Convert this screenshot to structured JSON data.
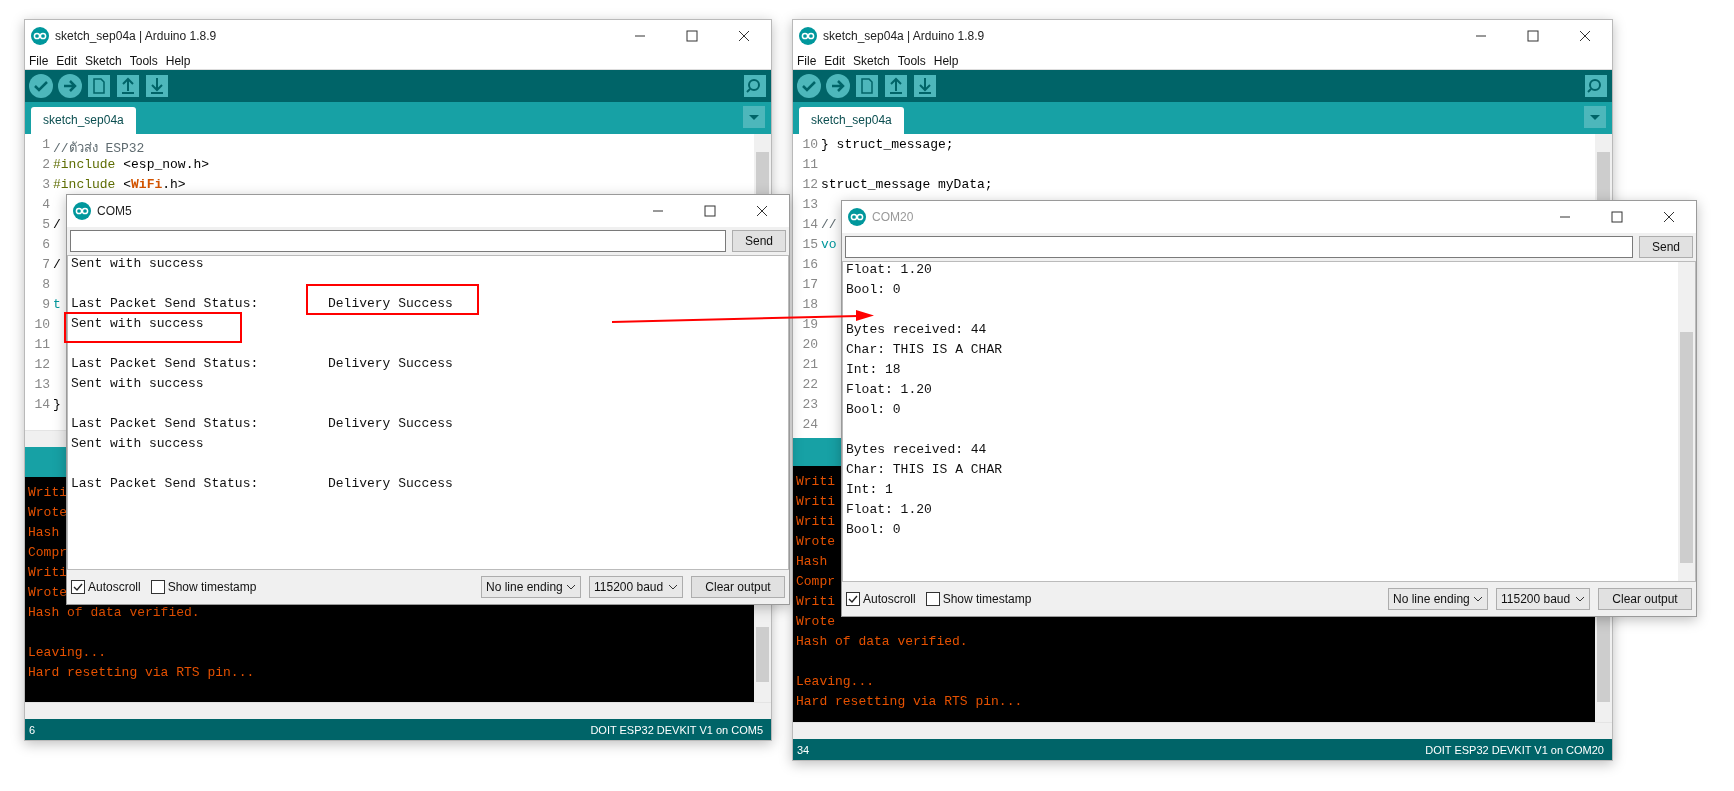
{
  "ide_windows": [
    {
      "title": "sketch_sep04a | Arduino 1.8.9",
      "menu": [
        "File",
        "Edit",
        "Sketch",
        "Tools",
        "Help"
      ],
      "tab": "sketch_sep04a",
      "code": [
        {
          "number": "1",
          "segments": [
            {
              "text": "//ตัวส่ง ESP32",
              "kind": "comment"
            }
          ]
        },
        {
          "number": "2",
          "segments": [
            {
              "text": "#include",
              "kind": "directive"
            },
            {
              "text": " <esp_now.h>",
              "kind": "plain"
            }
          ]
        },
        {
          "number": "3",
          "segments": [
            {
              "text": "#include",
              "kind": "directive"
            },
            {
              "text": " <",
              "kind": "plain"
            },
            {
              "text": "WiFi",
              "kind": "class"
            },
            {
              "text": ".h>",
              "kind": "plain"
            }
          ]
        },
        {
          "number": "4"
        },
        {
          "number": "5",
          "segments": [
            {
              "text": "/",
              "kind": "plain"
            }
          ]
        },
        {
          "number": "6"
        },
        {
          "number": "7",
          "segments": [
            {
              "text": "/",
              "kind": "plain"
            }
          ]
        },
        {
          "number": "8"
        },
        {
          "number": "9",
          "segments": [
            {
              "text": "t",
              "kind": "keyword"
            }
          ]
        },
        {
          "number": "10"
        },
        {
          "number": "11"
        },
        {
          "number": "12"
        },
        {
          "number": "13"
        },
        {
          "number": "14",
          "segments": [
            {
              "text": "}",
              "kind": "plain"
            }
          ]
        }
      ],
      "console": [
        {
          "kind": "text",
          "text": "Writi"
        },
        {
          "kind": "text",
          "text": "Wrote"
        },
        {
          "kind": "text",
          "text": "Hash"
        },
        {
          "kind": "text",
          "text": "Compr"
        },
        {
          "kind": "text",
          "text": "Writi"
        },
        {
          "kind": "text",
          "text": "Wrote"
        },
        {
          "kind": "text",
          "text": "Hash of data verified."
        },
        {
          "kind": "blank"
        },
        {
          "kind": "text",
          "text": "Leaving..."
        },
        {
          "kind": "text",
          "text": "Hard resetting via RTS pin..."
        }
      ],
      "status": {
        "line": "6",
        "board": "DOIT ESP32 DEVKIT V1 on COM5"
      }
    },
    {
      "title": "sketch_sep04a | Arduino 1.8.9",
      "menu": [
        "File",
        "Edit",
        "Sketch",
        "Tools",
        "Help"
      ],
      "tab": "sketch_sep04a",
      "code": [
        {
          "number": "10",
          "segments": [
            {
              "text": "} struct_message;",
              "kind": "plain"
            }
          ]
        },
        {
          "number": "11"
        },
        {
          "number": "12",
          "segments": [
            {
              "text": "struct_message myData;",
              "kind": "plain"
            }
          ]
        },
        {
          "number": "13"
        },
        {
          "number": "14",
          "segments": [
            {
              "text": "//",
              "kind": "comment"
            }
          ]
        },
        {
          "number": "15",
          "segments": [
            {
              "text": "vo",
              "kind": "keyword"
            }
          ]
        },
        {
          "number": "16"
        },
        {
          "number": "17"
        },
        {
          "number": "18"
        },
        {
          "number": "19"
        },
        {
          "number": "20"
        },
        {
          "number": "21"
        },
        {
          "number": "22"
        },
        {
          "number": "23"
        },
        {
          "number": "24"
        }
      ],
      "console": [
        {
          "kind": "text",
          "text": "Writi"
        },
        {
          "kind": "text",
          "text": "Writi"
        },
        {
          "kind": "text",
          "text": "Writi"
        },
        {
          "kind": "text",
          "text": "Wrote"
        },
        {
          "kind": "text",
          "text": "Hash"
        },
        {
          "kind": "text",
          "text": "Compr"
        },
        {
          "kind": "text",
          "text": "Writi"
        },
        {
          "kind": "text",
          "text": "Wrote"
        },
        {
          "kind": "text",
          "text": "Hash of data verified."
        },
        {
          "kind": "blank"
        },
        {
          "kind": "text",
          "text": "Leaving..."
        },
        {
          "kind": "text",
          "text": "Hard resetting via RTS pin..."
        }
      ],
      "status": {
        "line": "34",
        "board": "DOIT ESP32 DEVKIT V1 on COM20"
      }
    }
  ],
  "serial_monitors": [
    {
      "title": "COM5",
      "send": "Send",
      "output": [
        {
          "kind": "text",
          "text": "Sent with success"
        },
        {
          "kind": "blank"
        },
        {
          "kind": "status",
          "label": "Last Packet Send Status:",
          "value": "Delivery Success"
        },
        {
          "kind": "text",
          "text": "Sent with success"
        },
        {
          "kind": "blank"
        },
        {
          "kind": "status",
          "label": "Last Packet Send Status:",
          "value": "Delivery Success"
        },
        {
          "kind": "text",
          "text": "Sent with success"
        },
        {
          "kind": "blank"
        },
        {
          "kind": "status",
          "label": "Last Packet Send Status:",
          "value": "Delivery Success"
        },
        {
          "kind": "text",
          "text": "Sent with success"
        },
        {
          "kind": "blank"
        },
        {
          "kind": "status",
          "label": "Last Packet Send Status:",
          "value": "Delivery Success"
        }
      ],
      "autoscroll": {
        "label": "Autoscroll",
        "checked": true
      },
      "timestamp": {
        "label": "Show timestamp",
        "checked": false
      },
      "line_ending": "No line ending",
      "baud": "115200 baud",
      "clear": "Clear output"
    },
    {
      "title": "COM20",
      "send": "Send",
      "output": [
        {
          "kind": "text",
          "text": "Float: 1.20"
        },
        {
          "kind": "text",
          "text": "Bool: 0"
        },
        {
          "kind": "blank"
        },
        {
          "kind": "text",
          "text": "Bytes received: 44"
        },
        {
          "kind": "text",
          "text": "Char: THIS IS A CHAR"
        },
        {
          "kind": "text",
          "text": "Int: 18"
        },
        {
          "kind": "text",
          "text": "Float: 1.20"
        },
        {
          "kind": "text",
          "text": "Bool: 0"
        },
        {
          "kind": "blank"
        },
        {
          "kind": "text",
          "text": "Bytes received: 44"
        },
        {
          "kind": "text",
          "text": "Char: THIS IS A CHAR"
        },
        {
          "kind": "text",
          "text": "Int: 1"
        },
        {
          "kind": "text",
          "text": "Float: 1.20"
        },
        {
          "kind": "text",
          "text": "Bool: 0"
        }
      ],
      "autoscroll": {
        "label": "Autoscroll",
        "checked": true
      },
      "timestamp": {
        "label": "Show timestamp",
        "checked": false
      },
      "line_ending": "No line ending",
      "baud": "115200 baud",
      "clear": "Clear output"
    }
  ]
}
